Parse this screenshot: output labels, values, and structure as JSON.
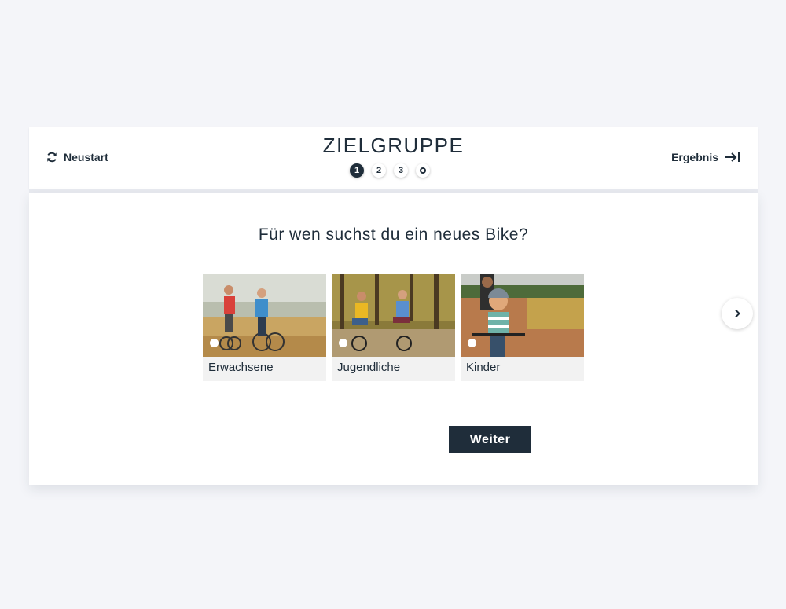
{
  "header": {
    "restart_label": "Neustart",
    "title": "ZIELGRUPPE",
    "result_label": "Ergebnis",
    "steps": [
      {
        "label": "1",
        "active": true
      },
      {
        "label": "2",
        "active": false
      },
      {
        "label": "3",
        "active": false
      },
      {
        "label": "",
        "active": false
      }
    ]
  },
  "main": {
    "question": "Für wen suchst du ein neues Bike?",
    "options": [
      {
        "label": "Erwachsene",
        "selected": false
      },
      {
        "label": "Jugendliche",
        "selected": false
      },
      {
        "label": "Kinder",
        "selected": false
      }
    ],
    "continue_label": "Weiter"
  },
  "icons": {
    "restart": "refresh-icon",
    "result": "arrow-right-to-bar-icon",
    "next": "chevron-right-icon"
  },
  "colors": {
    "primary": "#1f2d3a",
    "background": "#f4f5f9"
  }
}
